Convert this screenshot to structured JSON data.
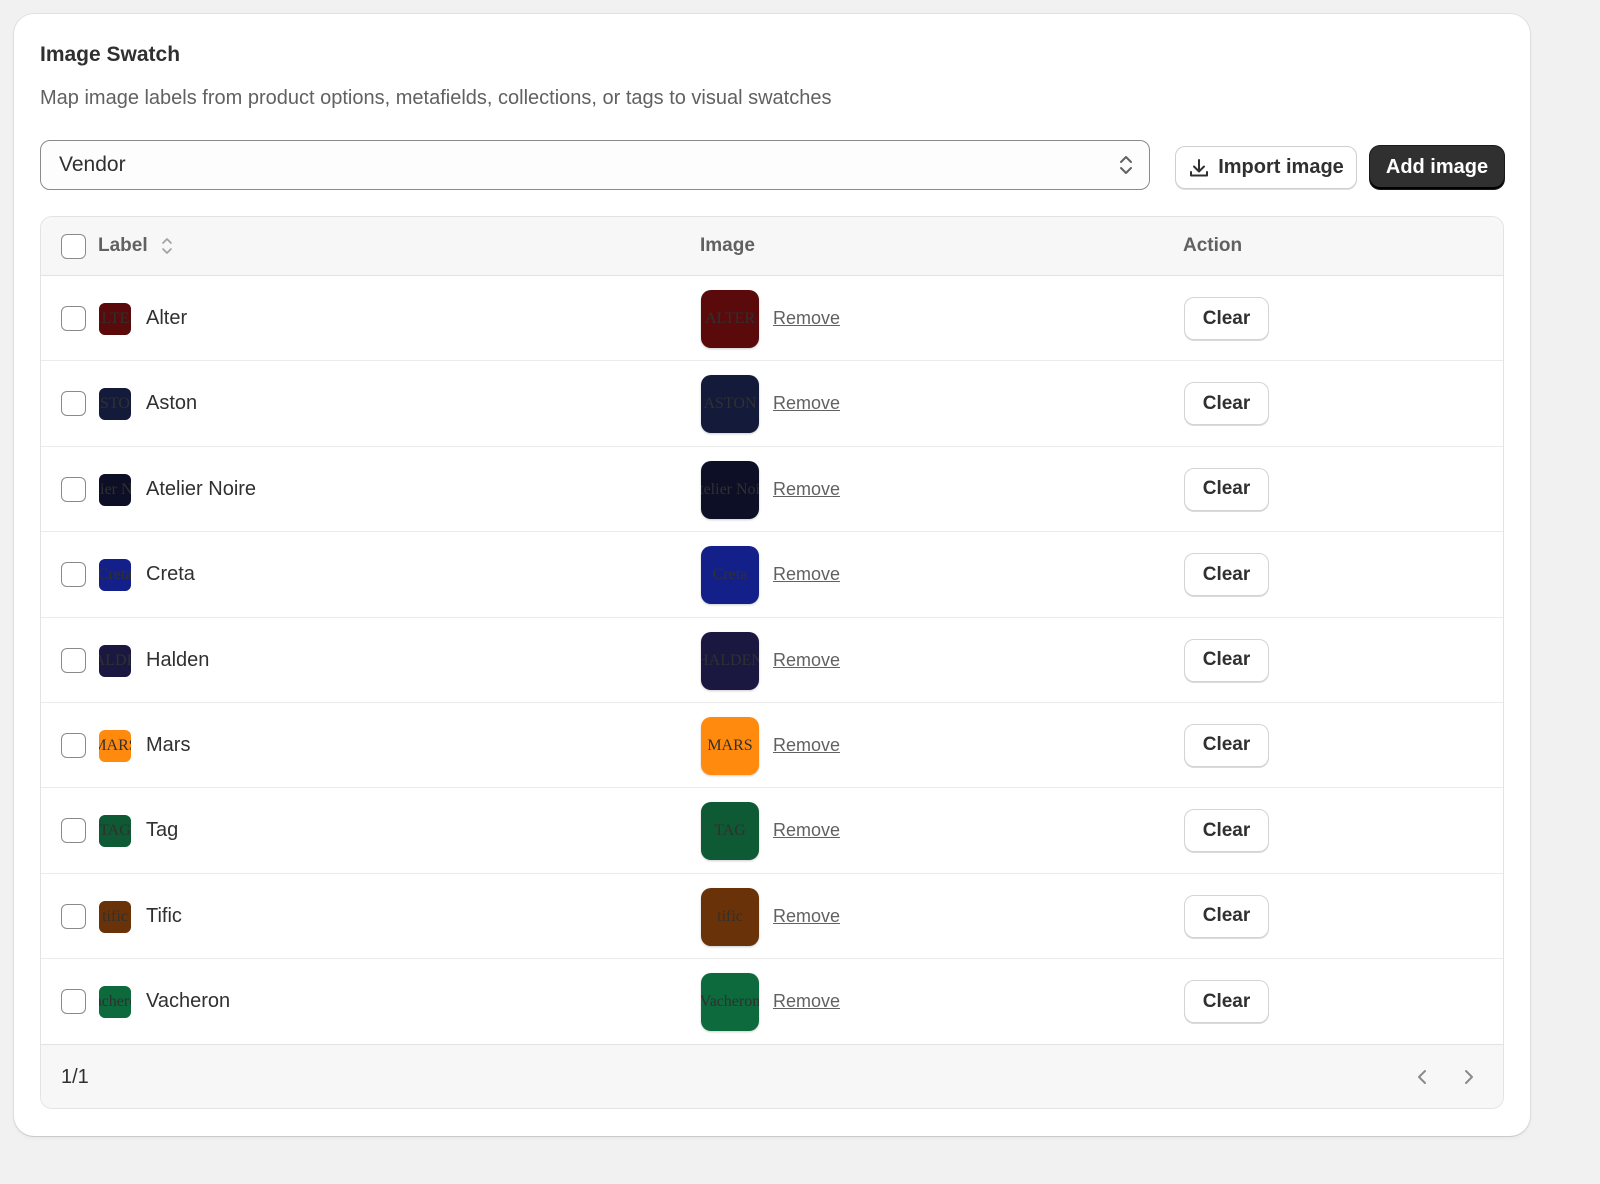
{
  "card": {
    "title": "Image Swatch",
    "description": "Map image labels from product options, metafields, collections, or tags to visual swatches"
  },
  "source_select": {
    "value": "Vendor"
  },
  "toolbar": {
    "import_label": "Import image",
    "add_label": "Add image"
  },
  "table": {
    "columns": {
      "label": "Label",
      "image": "Image",
      "action": "Action"
    },
    "remove_label": "Remove",
    "clear_label": "Clear",
    "rows": [
      {
        "label": "Alter",
        "logo": "ALTER",
        "bg": "#5a0a0a",
        "fg": "#c8926a"
      },
      {
        "label": "Aston",
        "logo": "ASTON",
        "bg": "#141a3a",
        "fg": "#e6e6f0"
      },
      {
        "label": "Atelier Noire",
        "logo": "Atelier Noire",
        "bg": "#0d0f26",
        "fg": "#a88a4e"
      },
      {
        "label": "Creta",
        "logo": "Creta",
        "bg": "#14208a",
        "fg": "#ffffff"
      },
      {
        "label": "Halden",
        "logo": "HALDEN",
        "bg": "#1a1840",
        "fg": "#d6c070"
      },
      {
        "label": "Mars",
        "logo": "MARS",
        "bg": "#ff8a0e",
        "fg": "#111111"
      },
      {
        "label": "Tag",
        "logo": "TAG",
        "bg": "#0e5a34",
        "fg": "#f2d27a"
      },
      {
        "label": "Tific",
        "logo": "tific",
        "bg": "#6a3208",
        "fg": "#f0d8b8"
      },
      {
        "label": "Vacheron",
        "logo": "Vacheron",
        "bg": "#0c6a3c",
        "fg": "#c8b870"
      }
    ]
  },
  "pagination": {
    "text": "1/1"
  }
}
